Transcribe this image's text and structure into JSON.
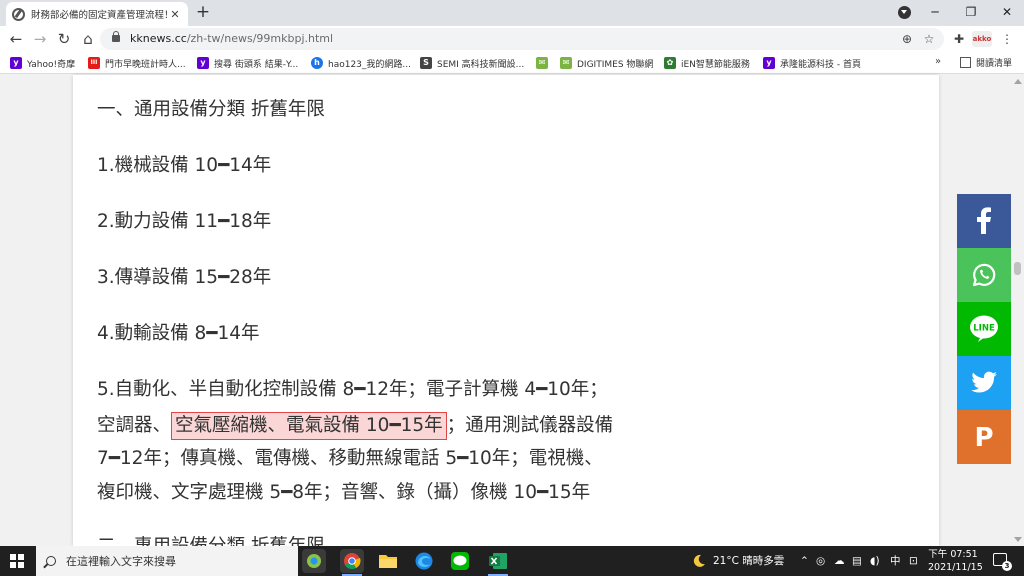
{
  "tab": {
    "title": "財務部必備的固定資產管理流程！"
  },
  "address": {
    "domain": "kknews.cc",
    "path": "/zh-tw/news/99mkbpj.html"
  },
  "toolbar": {
    "profile_label": "akko"
  },
  "bookmarks": [
    {
      "label": "Yahoo!奇摩",
      "icon": "yahoo-icon",
      "color": "#6001d2",
      "glyph": "y"
    },
    {
      "label": "門市早晚班計時人...",
      "icon": "store-icon",
      "color": "#e41b17",
      "glyph": "III"
    },
    {
      "label": "搜尋 街頭系 結果-Y...",
      "icon": "yahoo-icon",
      "color": "#6001d2",
      "glyph": "y"
    },
    {
      "label": "hao123_我的網路...",
      "icon": "hao123-icon",
      "color": "#1a73e8",
      "glyph": "h"
    },
    {
      "label": "SEMI 高科技新聞設...",
      "icon": "semi-icon",
      "color": "#444444",
      "glyph": "S"
    },
    {
      "label": "",
      "icon": "mail-icon",
      "color": "#7cb342",
      "glyph": "✉"
    },
    {
      "label": "DIGITIMES 物聯網",
      "icon": "digitimes-icon",
      "color": "#7cb342",
      "glyph": "✉"
    },
    {
      "label": "iEN智慧節能服務",
      "icon": "ien-icon",
      "color": "#2e7d32",
      "glyph": "✿"
    },
    {
      "label": "承隆能源科技 - 首頁",
      "icon": "yahoo-icon",
      "color": "#6001d2",
      "glyph": "y"
    }
  ],
  "reading_list": {
    "label": "閱讀清單"
  },
  "article": {
    "heading": "一、通用設備分類 折舊年限",
    "items": [
      "1.機械設備 10━14年",
      "2.動力設備 11━18年",
      "3.傳導設備 15━28年",
      "4.動輸設備 8━14年"
    ],
    "para5": {
      "line1": "5.自動化、半自動化控制設備 8━12年；電子計算機 4━10年；",
      "line2_before": "空調器、",
      "line2_highlight": "空氣壓縮機、電氣設備 10━15年",
      "line2_after": "；通用測試儀器設備",
      "line3": "7━12年；傳真機、電傳機、移動無線電話 5━10年；電視機、",
      "line4": "複印機、文字處理機 5━8年；音響、錄（攝）像機 10━15年"
    },
    "next_heading": "二、專用設備分類 折舊年限"
  },
  "share": [
    {
      "name": "facebook",
      "color": "#3b5998"
    },
    {
      "name": "whatsapp",
      "color": "#4bc35b"
    },
    {
      "name": "line",
      "color": "#00b900",
      "label": "LINE"
    },
    {
      "name": "twitter",
      "color": "#1da1f2"
    },
    {
      "name": "plurk",
      "color": "#e0712c",
      "label": "P"
    }
  ],
  "taskbar": {
    "search_placeholder": "在這裡輸入文字來搜尋",
    "weather": "21°C  晴時多雲",
    "ime": "中",
    "time": "下午 07:51",
    "date": "2021/11/15",
    "notifications": "3"
  }
}
